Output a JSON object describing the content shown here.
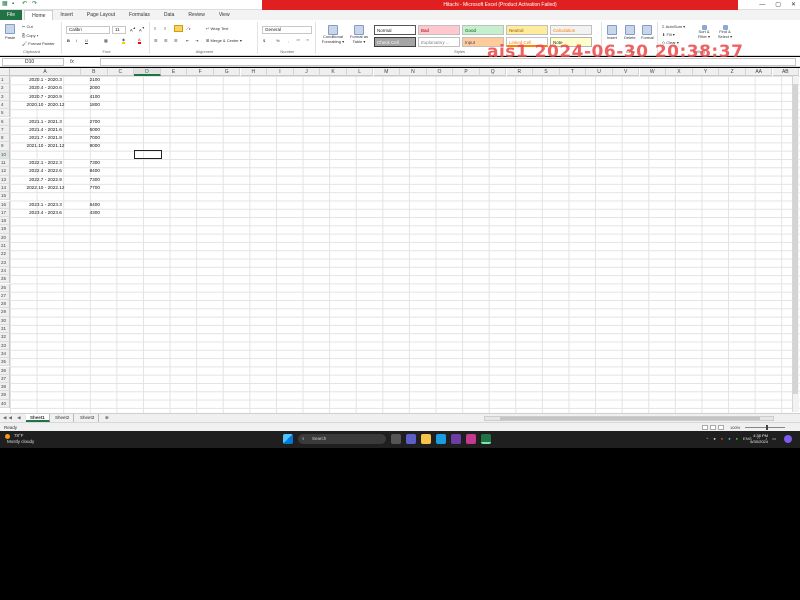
{
  "window": {
    "title": "Hitachi - Microsoft Excel (Product Activation Failed)",
    "controls": [
      "—",
      "▢",
      "✕"
    ]
  },
  "tabs": [
    "File",
    "Home",
    "Insert",
    "Page Layout",
    "Formulas",
    "Data",
    "Review",
    "View"
  ],
  "ribbon": {
    "clipboard": {
      "paste": "Paste",
      "cut": "Cut",
      "copy": "Copy ▾",
      "painter": "Format Painter",
      "label": "Clipboard"
    },
    "font": {
      "family": "Calibri",
      "size": "11",
      "label": "Font"
    },
    "alignment": {
      "wrap": "Wrap Text",
      "merge": "Merge & Center ▾",
      "label": "Alignment"
    },
    "number": {
      "format": "General",
      "currency": "$",
      "percent": "%",
      "comma": ",",
      "label": "Number"
    },
    "styles": {
      "conditional": "Conditional Formatting ▾",
      "format_table": "Format as Table ▾",
      "cells": [
        "Normal",
        "Bad",
        "Good",
        "Neutral",
        "Calculation",
        "Check Cell",
        "Explanatory ...",
        "Input",
        "Linked Cell",
        "Note"
      ],
      "label": "Styles"
    },
    "cells": {
      "insert": "Insert",
      "delete": "Delete",
      "format": "Format",
      "label": "Cells"
    },
    "editing": {
      "autosum": "AutoSum ▾",
      "fill": "Fill ▾",
      "clear": "Clear ▾",
      "sort": "Sort & Filter ▾",
      "find": "Find & Select ▾",
      "label": "Editing"
    }
  },
  "formula_bar": {
    "name_box": "D10",
    "fx": "fx",
    "formula": ""
  },
  "columns": [
    "A",
    "B",
    "C",
    "D",
    "E",
    "F",
    "G",
    "H",
    "I",
    "J",
    "K",
    "L",
    "M",
    "N",
    "O",
    "P",
    "Q",
    "R",
    "S",
    "T",
    "U",
    "V",
    "W",
    "X",
    "Y",
    "Z",
    "AA",
    "AB"
  ],
  "selected_column": "D",
  "selected_row": 10,
  "row_count": 40,
  "rows": [
    {
      "r": 1,
      "a": "2020.1 -  2020.3",
      "b": "2100"
    },
    {
      "r": 2,
      "a": "2020.4 -  2020.6",
      "b": "2000"
    },
    {
      "r": 3,
      "a": "2020.7 -  2020.9",
      "b": "4100"
    },
    {
      "r": 4,
      "a": "2020.10 -  2020.12",
      "b": "1800"
    },
    {
      "r": 6,
      "a": "2021.1 -  2021.3",
      "b": "2700"
    },
    {
      "r": 7,
      "a": "2021.4 -  2021.6",
      "b": "5000"
    },
    {
      "r": 8,
      "a": "2021.7 -  2021.9",
      "b": "7000"
    },
    {
      "r": 9,
      "a": "2021.10 -  2021.12",
      "b": "9000"
    },
    {
      "r": 11,
      "a": "2022.1 -  2022.3",
      "b": "7300"
    },
    {
      "r": 12,
      "a": "2022.4 -  2022.6",
      "b": "8400"
    },
    {
      "r": 13,
      "a": "2022.7 -  2022.9",
      "b": "7300"
    },
    {
      "r": 14,
      "a": "2022.10 -  2022.12",
      "b": "7700"
    },
    {
      "r": 16,
      "a": "2023.1 -  2023.3",
      "b": "6400"
    },
    {
      "r": 17,
      "a": "2023.4 -  2023.6",
      "b": "4300"
    }
  ],
  "sheets": [
    "Sheet1",
    "Sheet2",
    "Sheet3"
  ],
  "active_sheet": "Sheet1",
  "status": {
    "ready": "Ready",
    "zoom": "100%"
  },
  "taskbar": {
    "weather_temp": "78°F",
    "weather_desc": "Mostly cloudy",
    "search_placeholder": "Search",
    "lang": "ENG",
    "time": "4:38 PM",
    "date": "6/30/2024"
  },
  "watermark": "ajs1 2024-06-30 20:38:37",
  "colors": {
    "excel_green": "#217346",
    "title_red": "#e02020"
  }
}
